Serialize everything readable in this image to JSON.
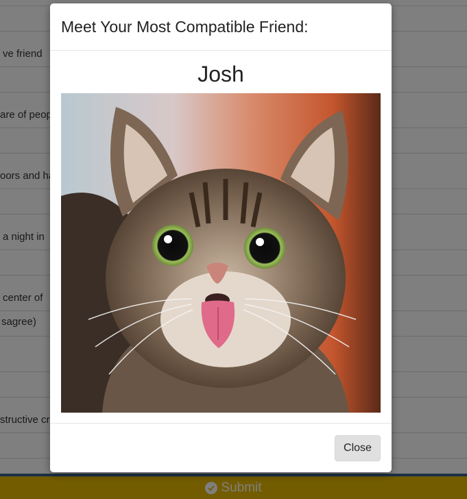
{
  "background": {
    "fragments": [
      "ve friend",
      "are of peop",
      "oors and ha",
      "a night in",
      "center of",
      "sagree)",
      "structive cr"
    ],
    "submit_label": "Submit"
  },
  "modal": {
    "title": "Meet Your Most Compatible Friend:",
    "friend_name": "Josh",
    "photo_icon": "cat-photo",
    "close_label": "Close"
  }
}
